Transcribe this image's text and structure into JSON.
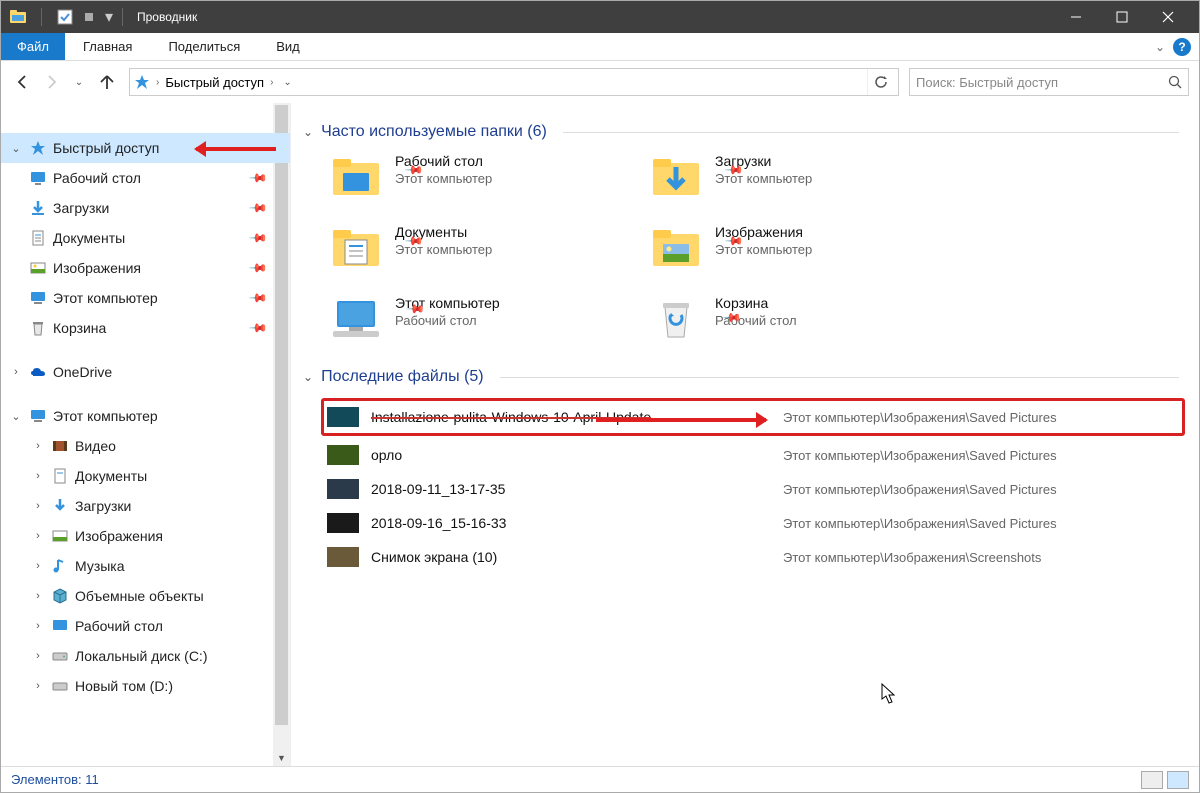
{
  "window": {
    "title": "Проводник"
  },
  "ribbon": {
    "file": "Файл",
    "tabs": [
      "Главная",
      "Поделиться",
      "Вид"
    ]
  },
  "address": {
    "segments": [
      "Быстрый доступ"
    ]
  },
  "search": {
    "placeholder": "Поиск: Быстрый доступ"
  },
  "sidebar": {
    "quick_access": "Быстрый доступ",
    "quick_items": [
      {
        "label": "Рабочий стол"
      },
      {
        "label": "Загрузки"
      },
      {
        "label": "Документы"
      },
      {
        "label": "Изображения"
      },
      {
        "label": "Этот компьютер"
      },
      {
        "label": "Корзина"
      }
    ],
    "onedrive": "OneDrive",
    "this_pc": "Этот компьютер",
    "pc_items": [
      {
        "label": "Видео"
      },
      {
        "label": "Документы"
      },
      {
        "label": "Загрузки"
      },
      {
        "label": "Изображения"
      },
      {
        "label": "Музыка"
      },
      {
        "label": "Объемные объекты"
      },
      {
        "label": "Рабочий стол"
      },
      {
        "label": "Локальный диск (C:)"
      },
      {
        "label": "Новый том (D:)"
      }
    ]
  },
  "sections": {
    "frequent": "Часто используемые папки (6)",
    "recent": "Последние файлы (5)"
  },
  "folders": [
    {
      "name": "Рабочий стол",
      "loc": "Этот компьютер",
      "icon": "desktop"
    },
    {
      "name": "Загрузки",
      "loc": "Этот компьютер",
      "icon": "downloads"
    },
    {
      "name": "Документы",
      "loc": "Этот компьютер",
      "icon": "documents"
    },
    {
      "name": "Изображения",
      "loc": "Этот компьютер",
      "icon": "pictures"
    },
    {
      "name": "Этот компьютер",
      "loc": "Рабочий стол",
      "icon": "pc"
    },
    {
      "name": "Корзина",
      "loc": "Рабочий стол",
      "icon": "recycle"
    }
  ],
  "files": [
    {
      "name": "Installazione-pulita-Windows-10-April-Update",
      "path": "Этот компьютер\\Изображения\\Saved Pictures",
      "highlight": true,
      "thumb": "#124a5a"
    },
    {
      "name": "орло",
      "path": "Этот компьютер\\Изображения\\Saved Pictures",
      "thumb": "#3a5a1a"
    },
    {
      "name": "2018-09-11_13-17-35",
      "path": "Этот компьютер\\Изображения\\Saved Pictures",
      "thumb": "#2a3a4a"
    },
    {
      "name": "2018-09-16_15-16-33",
      "path": "Этот компьютер\\Изображения\\Saved Pictures",
      "thumb": "#1a1a1a"
    },
    {
      "name": "Снимок экрана (10)",
      "path": "Этот компьютер\\Изображения\\Screenshots",
      "thumb": "#6a5a3a"
    }
  ],
  "status": {
    "items": "Элементов: 11"
  }
}
